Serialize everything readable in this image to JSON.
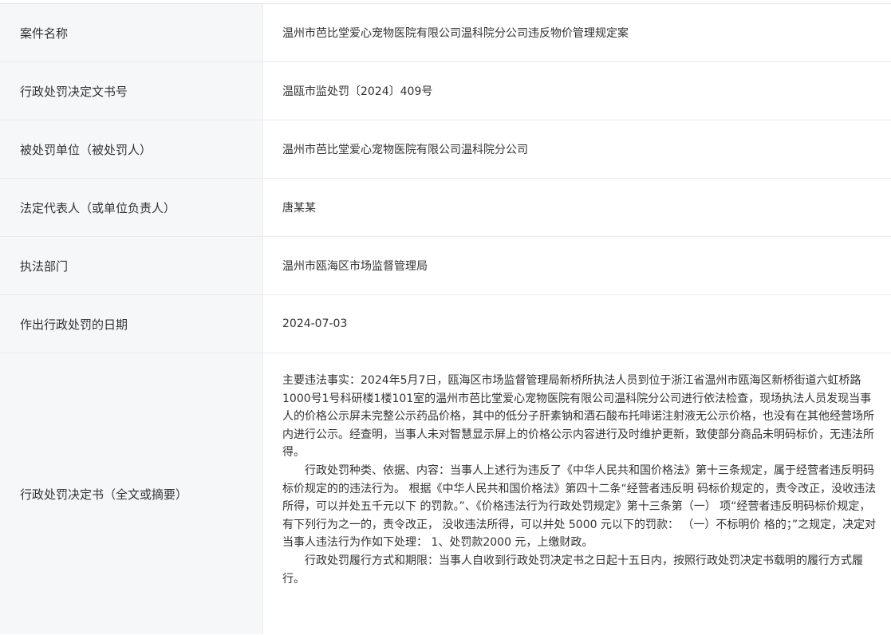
{
  "rows": [
    {
      "label": "案件名称",
      "value": "温州市芭比堂爱心宠物医院有限公司温科院分公司违反物价管理规定案"
    },
    {
      "label": "行政处罚决定文书号",
      "value": "温瓯市监处罚〔2024〕409号"
    },
    {
      "label": "被处罚单位（被处罚人）",
      "value": "温州市芭比堂爱心宠物医院有限公司温科院分公司"
    },
    {
      "label": "法定代表人（或单位负责人）",
      "value": "唐某某"
    },
    {
      "label": "执法部门",
      "value": "温州市瓯海区市场监督管理局"
    },
    {
      "label": "作出行政处罚的日期",
      "value": "2024-07-03"
    }
  ],
  "decision": {
    "label": "行政处罚决定书（全文或摘要）",
    "paragraphs": [
      "主要违法事实：2024年5月7日，瓯海区市场监督管理局新桥所执法人员到位于浙江省温州市瓯海区新桥街道六虹桥路1000号1号科研楼1楼101室的温州市芭比堂爱心宠物医院有限公司温科院分公司进行依法检查，现场执法人员发现当事人的价格公示屏未完整公示药品价格，其中的低分子肝素钠和酒石酸布托啡诺注射液无公示价格，也没有在其他经营场所内进行公示。经查明，当事人未对智慧显示屏上的价格公示内容进行及时维护更新，致使部分商品未明码标价，无违法所得。",
      "行政处罚种类、依据、内容：当事人上述行为违反了《中华人民共和国价格法》第十三条规定，属于经营者违反明码标价规定的的违法行为。 根据《中华人民共和国价格法》第四十二条“经营者违反明 码标价规定的，责令改正，没收违法所得，可以并处五千元以下 的罚款。”、《价格违法行为行政处罚规定》第十三条第（一） 项“经营者违反明码标价规定，有下列行为之一的，责令改正， 没收违法所得，可以并处 5000 元以下的罚款： （一）不标明价 格的；”之规定，决定对当事人违法行为作如下处理： 1、处罚款2000 元，上缴财政。",
      "行政处罚履行方式和期限：当事人自收到行政处罚决定书之日起十五日内，按照行政处罚决定书载明的履行方式履行。"
    ]
  }
}
